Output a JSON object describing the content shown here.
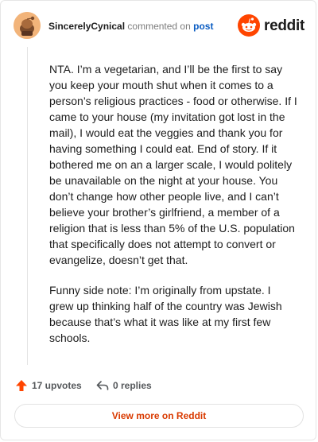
{
  "header": {
    "username": "SincerelyCynical",
    "action_text": "commented on",
    "post_link": "post",
    "brand_name": "reddit"
  },
  "comment": {
    "paragraphs": [
      "NTA. I’m a vegetarian, and I’ll be the first to say you keep your mouth shut when it comes to a person’s religious practices - food or otherwise. If I came to your house (my invitation got lost in the mail), I would eat the veggies and thank you for having something I could eat. End of story. If it bothered me on an a larger scale, I would politely be unavailable on the night at your house. You don’t change how other people live, and I can’t believe your brother’s girlfriend, a member of a religion that is less than 5% of the U.S. population that specifically does not attempt to convert or evangelize, doesn’t get that.",
      "Funny side note: I’m originally from upstate. I grew up thinking half of the country was Jewish because that’s what it was like at my first few schools."
    ]
  },
  "footer": {
    "upvotes_label": "17 upvotes",
    "replies_label": "0 replies",
    "view_more_label": "View more on Reddit"
  },
  "colors": {
    "brand_orange": "#ff4500",
    "link_blue": "#0a5cc2",
    "view_more_text": "#d93a00"
  },
  "icons": {
    "avatar": "snoo-avatar-icon",
    "brand": "reddit-logo-icon",
    "upvote": "upvote-arrow-icon",
    "reply": "reply-arrow-icon"
  }
}
